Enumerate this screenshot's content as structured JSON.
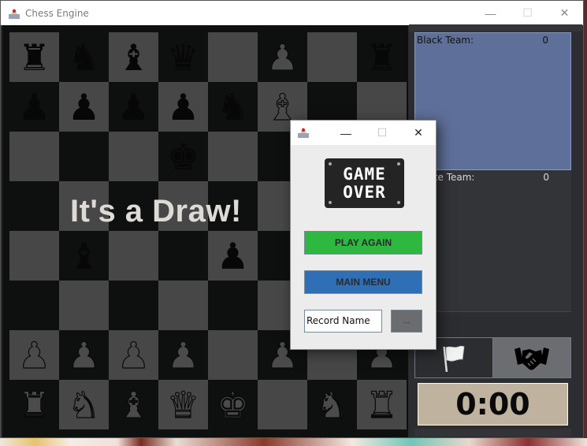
{
  "window": {
    "title": "Chess Engine",
    "controls": {
      "minimize": "—",
      "maximize": "☐",
      "close": "✕"
    }
  },
  "board": {
    "status_text": "It's a Draw!",
    "ranks": [
      [
        {
          "p": "♜",
          "c": "black"
        },
        {
          "p": "♞",
          "c": "black"
        },
        {
          "p": "♝",
          "c": "black"
        },
        {
          "p": "♛",
          "c": "black"
        },
        null,
        {
          "p": "♟",
          "c": "white"
        },
        null,
        {
          "p": "♜",
          "c": "black"
        }
      ],
      [
        {
          "p": "♟",
          "c": "black"
        },
        {
          "p": "♟",
          "c": "black"
        },
        {
          "p": "♟",
          "c": "black"
        },
        {
          "p": "♟",
          "c": "black"
        },
        {
          "p": "♞",
          "c": "black"
        },
        {
          "p": "♝",
          "c": "white"
        },
        null,
        null
      ],
      [
        null,
        null,
        null,
        {
          "p": "♚",
          "c": "black"
        },
        null,
        null,
        null,
        null
      ],
      [
        null,
        null,
        null,
        null,
        null,
        null,
        null,
        null
      ],
      [
        null,
        {
          "p": "♝",
          "c": "black"
        },
        null,
        null,
        {
          "p": "♟",
          "c": "black"
        },
        null,
        null,
        null
      ],
      [
        null,
        null,
        null,
        null,
        null,
        null,
        null,
        null
      ],
      [
        {
          "p": "♟",
          "c": "white"
        },
        {
          "p": "♟",
          "c": "white"
        },
        {
          "p": "♟",
          "c": "white"
        },
        {
          "p": "♟",
          "c": "white"
        },
        null,
        {
          "p": "♟",
          "c": "white"
        },
        null,
        {
          "p": "♟",
          "c": "white"
        }
      ],
      [
        {
          "p": "♜",
          "c": "white"
        },
        {
          "p": "♞",
          "c": "white"
        },
        {
          "p": "♝",
          "c": "white"
        },
        {
          "p": "♛",
          "c": "white"
        },
        {
          "p": "♚",
          "c": "white"
        },
        null,
        {
          "p": "♞",
          "c": "white"
        },
        {
          "p": "♜",
          "c": "white"
        }
      ]
    ]
  },
  "side_panel": {
    "black_team": {
      "label": "Black Team:",
      "count": "0"
    },
    "white_team": {
      "label": "White Team:",
      "count": "0"
    },
    "resign_icon": "white-flag-icon",
    "offer_draw_icon": "handshake-icon",
    "timer": "0:00"
  },
  "dialog": {
    "controls": {
      "minimize": "—",
      "maximize": "☐",
      "close": "✕"
    },
    "banner": {
      "line1": "GAME",
      "line2": "OVER"
    },
    "play_again": "PLAY AGAIN",
    "main_menu": "MAIN MENU",
    "record_name_value": "Record Name",
    "browse_label": "..."
  },
  "colors": {
    "light_square": "#474747",
    "dark_square": "#0e0f0f",
    "black_team_bg": "#5e6f99",
    "play_again": "#2fb840",
    "main_menu": "#2e6fb6",
    "timer_bg": "#bfb3a0"
  }
}
